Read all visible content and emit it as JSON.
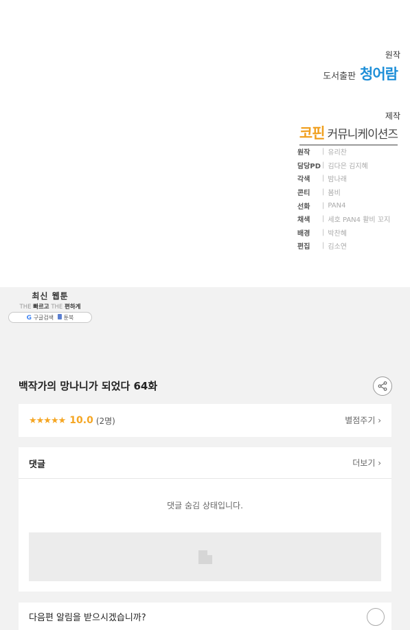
{
  "credits": {
    "original_label": "원작",
    "publisher_prefix": "도서출판",
    "publisher_name": "청어람",
    "production_label": "제작",
    "producer_brand": "코핀",
    "producer_rest": "커뮤니케이션즈",
    "staff": [
      {
        "role": "원작",
        "names": "유리찬"
      },
      {
        "role": "담당PD",
        "names": "김다은  김지혜"
      },
      {
        "role": "각색",
        "names": "밤나래"
      },
      {
        "role": "콘티",
        "names": "봄비"
      },
      {
        "role": "선화",
        "names": "PAN4"
      },
      {
        "role": "채색",
        "names": "세호  PAN4  활비  꼬지"
      },
      {
        "role": "배경",
        "names": "박찬혜"
      },
      {
        "role": "편집",
        "names": "김소연"
      }
    ]
  },
  "promo": {
    "title": "최신 웹툰",
    "the1": "THE",
    "word1": "빠르고",
    "the2": "THE",
    "word2": "편하게",
    "google_label": "구글검색",
    "brand": "툰북"
  },
  "episode": {
    "title": "백작가의 망나니가 되었다 64화"
  },
  "rating": {
    "stars": "★★★★★",
    "score": "10.0",
    "count": "(2명)",
    "rate_link": "별점주기 ›"
  },
  "comments": {
    "title": "댓글",
    "more": "더보기 ›",
    "hidden_message": "댓글 숨김 상태입니다."
  },
  "next": {
    "title": "다음편 알림을 받으시겠습니까?"
  }
}
